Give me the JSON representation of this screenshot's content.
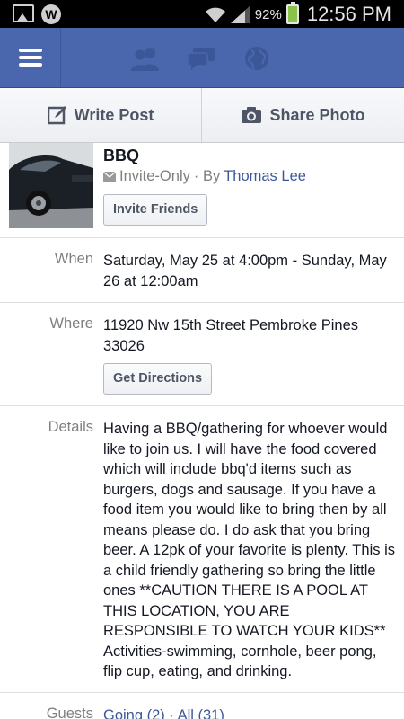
{
  "status_bar": {
    "battery_pct": "92%",
    "time": "12:56 PM"
  },
  "action_bar": {
    "write_post": "Write Post",
    "share_photo": "Share Photo"
  },
  "event": {
    "title": "BBQ",
    "privacy": "Invite-Only",
    "by_prefix": "· By",
    "host": "Thomas Lee",
    "invite_button": "Invite Friends"
  },
  "when": {
    "label": "When",
    "value": "Saturday, May 25 at 4:00pm - Sunday, May 26 at 12:00am"
  },
  "where": {
    "label": "Where",
    "value": "11920 Nw 15th Street Pembroke Pines 33026",
    "directions_button": "Get Directions"
  },
  "details": {
    "label": "Details",
    "value": "Having a BBQ/gathering for whoever would like to join us. I will have the food covered which will include bbq'd items such as burgers, dogs and sausage. If you have a food item you would like to bring then by all means please do. I do ask that you bring beer. A 12pk of your favorite is plenty. This is a child friendly gathering so bring the little ones **CAUTION THERE IS A POOL AT THIS LOCATION, YOU ARE RESPONSIBLE TO WATCH YOUR KIDS** Activities-swimming, cornhole, beer pong, flip cup, eating, and drinking."
  },
  "guests": {
    "label": "Guests",
    "going": "Going (2)",
    "separator": "·",
    "all": "All (31)"
  },
  "colors": {
    "nav_blue": "#4a67ad",
    "link_blue": "#3b5998",
    "battery_green": "#8bc34a"
  },
  "icons": [
    "image-icon",
    "w-app-icon",
    "wifi-icon",
    "signal-icon",
    "battery-icon",
    "menu-icon",
    "friend-requests-icon",
    "messages-icon",
    "notifications-globe-icon",
    "edit-icon",
    "camera-icon",
    "envelope-icon"
  ]
}
